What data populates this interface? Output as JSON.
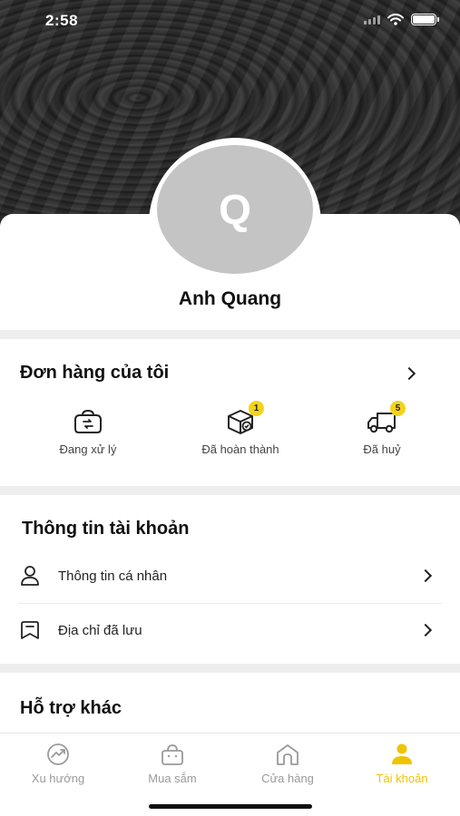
{
  "status_bar": {
    "time": "2:58"
  },
  "profile": {
    "avatar_initial": "Q",
    "name": "Anh Quang"
  },
  "orders": {
    "title": "Đơn hàng của tôi",
    "items": [
      {
        "label": "Đang xử lý",
        "badge": ""
      },
      {
        "label": "Đã hoàn thành",
        "badge": "1"
      },
      {
        "label": "Đã huỷ",
        "badge": "5"
      }
    ]
  },
  "account": {
    "title": "Thông tin tài khoản",
    "rows": [
      {
        "label": "Thông tin cá nhân"
      },
      {
        "label": "Địa chỉ đã lưu"
      }
    ]
  },
  "support": {
    "title": "Hỗ trợ khác"
  },
  "tabbar": {
    "tabs": [
      {
        "label": "Xu hướng"
      },
      {
        "label": "Mua sắm"
      },
      {
        "label": "Cửa hàng"
      },
      {
        "label": "Tài khoản"
      }
    ]
  },
  "colors": {
    "accent": "#f0c400",
    "badge": "#f5d31a",
    "inactive": "#9a9a9a"
  }
}
